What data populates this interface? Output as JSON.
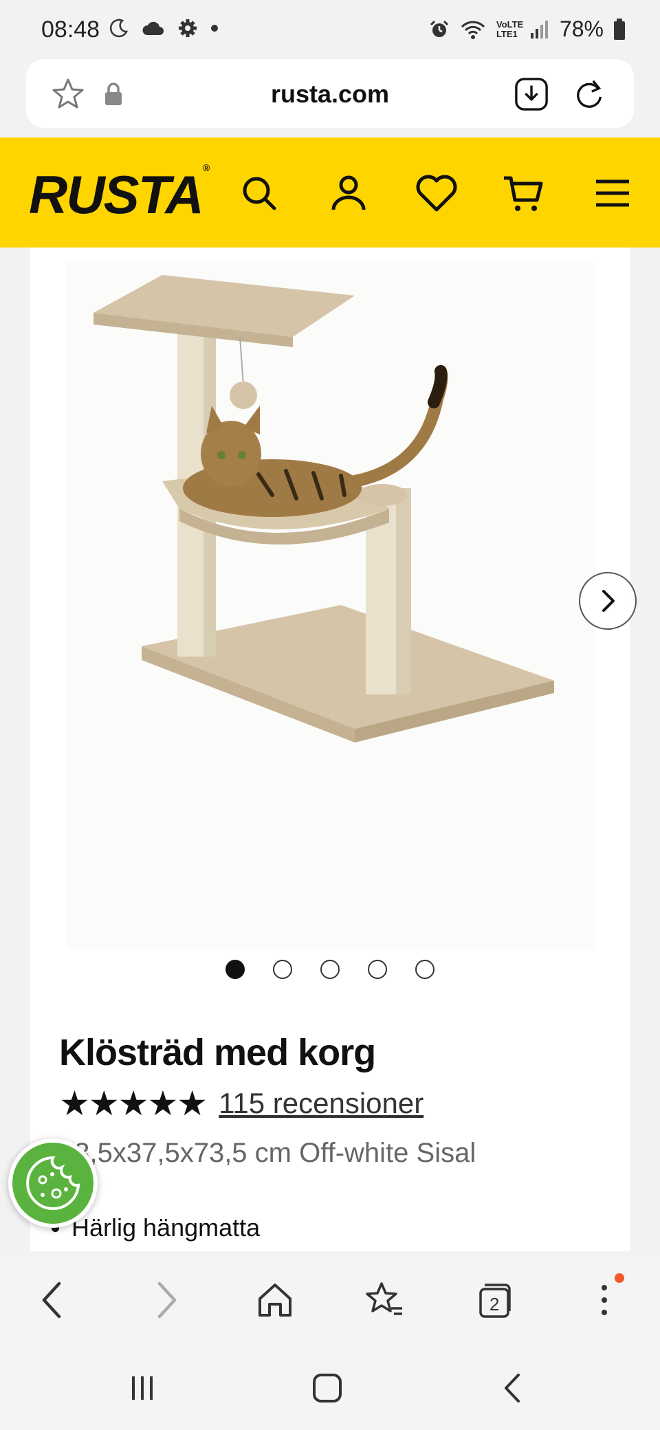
{
  "status_bar": {
    "time": "08:48",
    "battery": "78%",
    "network": "VoLTE LTE1",
    "icons": [
      "moon-icon",
      "cloud-icon",
      "gear-icon",
      "dot-icon",
      "alarm-icon",
      "wifi-icon",
      "signal-icon",
      "battery-icon"
    ]
  },
  "browser": {
    "url": "rusta.com",
    "tabs_count": "2"
  },
  "site": {
    "logo": "RUSTA",
    "brand_color": "#ffd500"
  },
  "product": {
    "title": "Klösträd med korg",
    "rating": 4.5,
    "stars": "★★★★★",
    "reviews_label": "115 recensioner",
    "variant": "73,5x37,5x73,5 cm Off-white Sisal",
    "bullets": [
      "Härlig hängmatta"
    ],
    "image_count": 5,
    "active_image": 1
  },
  "colors": {
    "cookie_green": "#5ab33e",
    "notification": "#f0582c"
  }
}
